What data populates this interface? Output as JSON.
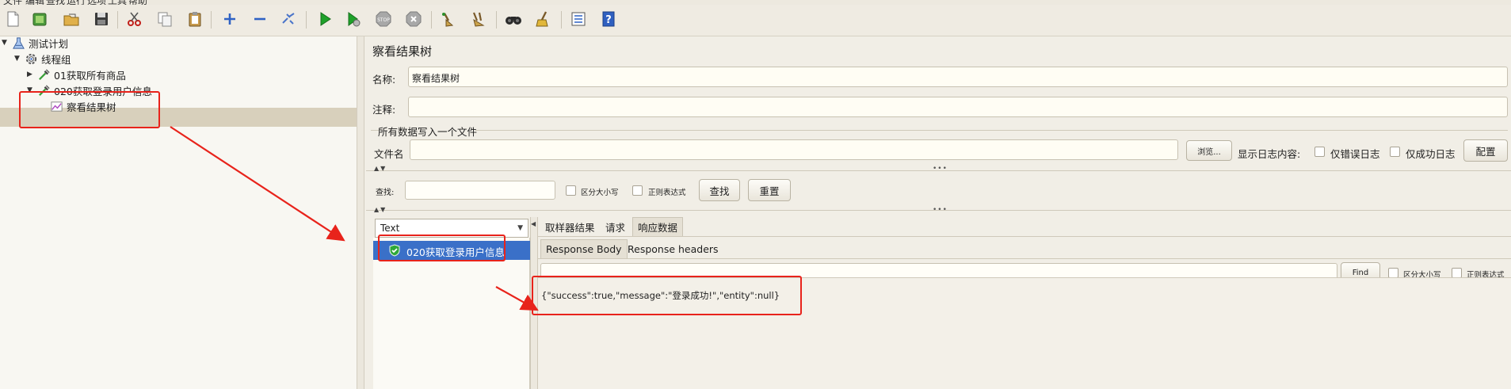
{
  "menu": [
    "文件",
    "编辑",
    "查找",
    "运行",
    "选项",
    "工具",
    "帮助"
  ],
  "toolbar": {
    "icons": [
      "new-icon",
      "templates-icon",
      "open-icon",
      "save-icon",
      "cut-icon",
      "copy-icon",
      "paste-icon",
      "expand-icon",
      "collapse-icon",
      "toggle-icon",
      "start-icon",
      "start-no-pause-icon",
      "stop-icon",
      "shutdown-icon",
      "clear-icon",
      "clear-all-icon",
      "search-icon",
      "reset-search-icon",
      "function-helper-icon",
      "help-icon"
    ]
  },
  "tree": {
    "plan": "测试计划",
    "thread_group": "线程组",
    "sampler1": "01获取所有商品",
    "sampler2": "020获取登录用户信息",
    "listener": "察看结果树"
  },
  "panel": {
    "title": "察看结果树",
    "name_label": "名称:",
    "name_value": "察看结果树",
    "comment_label": "注释:",
    "comment_value": "",
    "file_section": "所有数据写入一个文件",
    "filename_label": "文件名",
    "filename_value": "",
    "browse_button": "浏览...",
    "log_display_label": "显示日志内容:",
    "errors_only": "仅错误日志",
    "successes_only": "仅成功日志",
    "configure_button": "配置"
  },
  "search": {
    "label": "查找:",
    "value": "",
    "case_sensitive": "区分大小写",
    "regex": "正则表达式",
    "find_button": "查找",
    "reset_button": "重置"
  },
  "results": {
    "renderer": "Text",
    "items": [
      "020获取登录用户信息"
    ]
  },
  "detail": {
    "tabs": [
      "取样器结果",
      "请求",
      "响应数据"
    ],
    "active_tab": "响应数据",
    "subtabs": [
      "Response Body",
      "Response headers"
    ],
    "active_subtab": "Response Body",
    "find_value": "",
    "find_button": "Find",
    "case_sensitive": "区分大小写",
    "regex": "正则表达式",
    "body": "{\"success\":true,\"message\":\"登录成功!\",\"entity\":null}"
  },
  "colors": {
    "annotation": "#e8231b",
    "selection": "#3a70c8",
    "tree_selection": "#d8d0bc"
  }
}
